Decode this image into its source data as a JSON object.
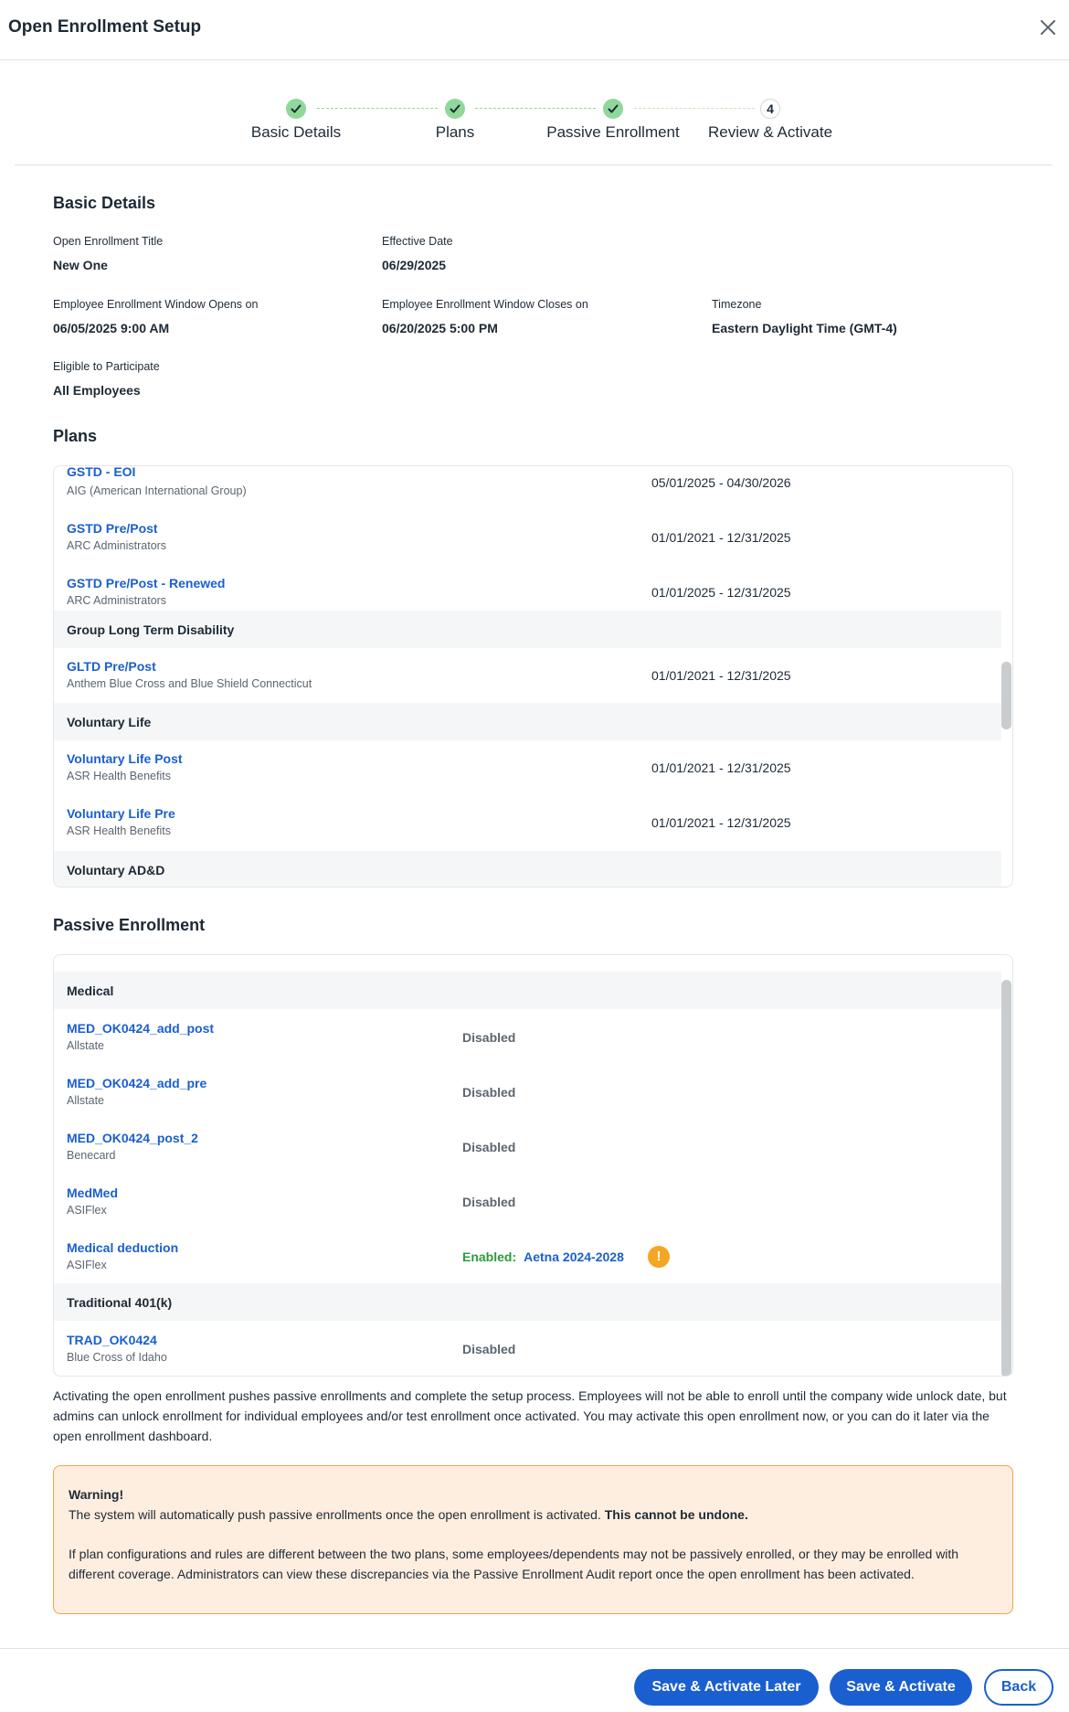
{
  "header": {
    "title": "Open Enrollment Setup",
    "close_icon": "close-icon"
  },
  "stepper": {
    "steps": [
      {
        "label": "Basic Details",
        "state": "done"
      },
      {
        "label": "Plans",
        "state": "done"
      },
      {
        "label": "Passive Enrollment",
        "state": "done"
      },
      {
        "label": "Review & Activate",
        "state": "current",
        "number": "4"
      }
    ]
  },
  "basic_details": {
    "title": "Basic Details",
    "fields": {
      "oe_title": {
        "label": "Open Enrollment Title",
        "value": "New One"
      },
      "effective_date": {
        "label": "Effective Date",
        "value": "06/29/2025"
      },
      "window_opens": {
        "label": "Employee Enrollment Window Opens on",
        "value": "06/05/2025 9:00 AM"
      },
      "window_closes": {
        "label": "Employee Enrollment Window Closes on",
        "value": "06/20/2025 5:00 PM"
      },
      "timezone": {
        "label": "Timezone",
        "value": "Eastern Daylight Time (GMT-4)"
      },
      "eligible": {
        "label": "Eligible to Participate",
        "value": "All Employees"
      }
    }
  },
  "plans": {
    "title": "Plans",
    "rows": [
      {
        "type": "plan",
        "name": "GSTD - EOI",
        "carrier": "AIG (American International Group)",
        "dates": "05/01/2025 - 04/30/2026"
      },
      {
        "type": "plan",
        "name": "GSTD Pre/Post",
        "carrier": "ARC Administrators",
        "dates": "01/01/2021 - 12/31/2025"
      },
      {
        "type": "plan",
        "name": "GSTD Pre/Post - Renewed",
        "carrier": "ARC Administrators",
        "dates": "01/01/2025 - 12/31/2025"
      },
      {
        "type": "group",
        "name": "Group Long Term Disability"
      },
      {
        "type": "plan",
        "name": "GLTD Pre/Post",
        "carrier": "Anthem Blue Cross and Blue Shield Connecticut",
        "dates": "01/01/2021 - 12/31/2025"
      },
      {
        "type": "group",
        "name": "Voluntary Life"
      },
      {
        "type": "plan",
        "name": "Voluntary Life Post",
        "carrier": "ASR Health Benefits",
        "dates": "01/01/2021 - 12/31/2025"
      },
      {
        "type": "plan",
        "name": "Voluntary Life Pre",
        "carrier": "ASR Health Benefits",
        "dates": "01/01/2021 - 12/31/2025"
      },
      {
        "type": "group",
        "name": "Voluntary AD&D"
      }
    ]
  },
  "passive": {
    "title": "Passive Enrollment",
    "rows": [
      {
        "type": "group",
        "name": "Medical"
      },
      {
        "type": "plan",
        "name": "MED_OK0424_add_post",
        "carrier": "Allstate",
        "status": "Disabled"
      },
      {
        "type": "plan",
        "name": "MED_OK0424_add_pre",
        "carrier": "Allstate",
        "status": "Disabled"
      },
      {
        "type": "plan",
        "name": "MED_OK0424_post_2",
        "carrier": "Benecard",
        "status": "Disabled"
      },
      {
        "type": "plan",
        "name": "MedMed",
        "carrier": "ASIFlex",
        "status": "Disabled"
      },
      {
        "type": "plan",
        "name": "Medical deduction",
        "carrier": "ASIFlex",
        "status": "Enabled:",
        "status_link": "Aetna 2024-2028",
        "warning_icon": "!"
      },
      {
        "type": "group",
        "name": "Traditional 401(k)"
      },
      {
        "type": "plan",
        "name": "TRAD_OK0424",
        "carrier": "Blue Cross of Idaho",
        "status": "Disabled"
      }
    ]
  },
  "info_text": "Activating the open enrollment pushes passive enrollments and complete the setup process. Employees will not be able to enroll until the company wide unlock date, but admins can unlock enrollment for individual employees and/or test enrollment once activated. You may activate this open enrollment now, or you can do it later via the open enrollment dashboard.",
  "warning": {
    "title": "Warning!",
    "line1": "The system will automatically push passive enrollments once the open enrollment is activated. ",
    "line1_bold": "This cannot be undone.",
    "line2": "If plan configurations and rules are different between the two plans, some employees/dependents may not be passively enrolled, or they may be enrolled with different coverage. Administrators can view these discrepancies via the Passive Enrollment Audit report once the open enrollment has been activated."
  },
  "footer": {
    "save_later": "Save & Activate Later",
    "save_activate": "Save & Activate",
    "back": "Back"
  },
  "colors": {
    "accent": "#1a5fd0",
    "success": "#2a9d3a",
    "step_done": "#8fd89a",
    "warning_bg": "#feeedf",
    "warning_border": "#f2a34a"
  }
}
